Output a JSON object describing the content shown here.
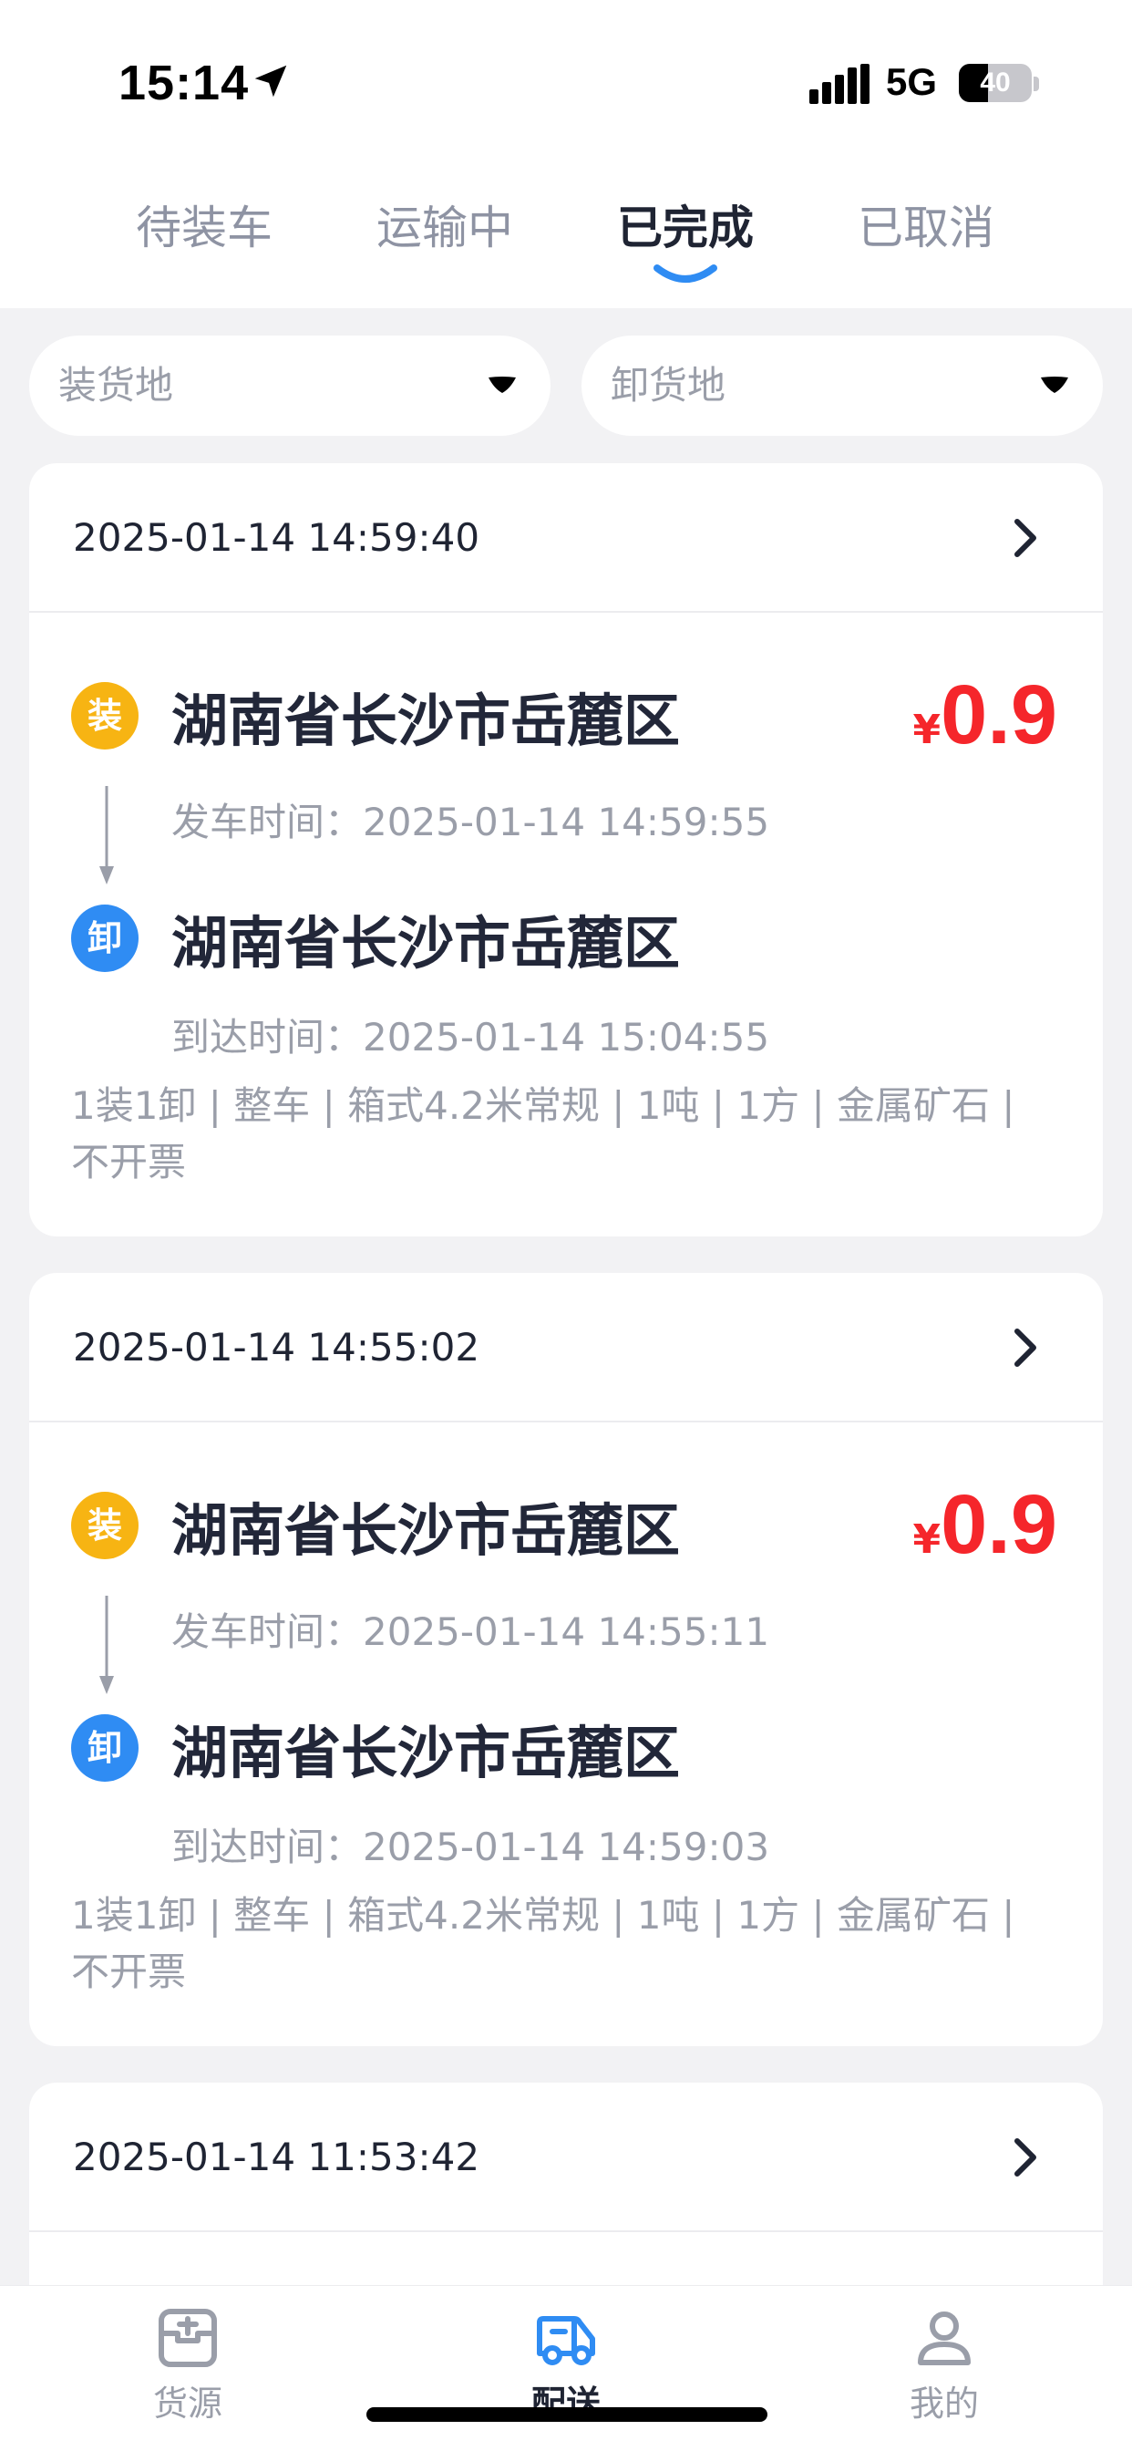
{
  "status_bar": {
    "time": "15:14",
    "network": "5G",
    "battery": "40",
    "battery_level": 0.4
  },
  "tabs": [
    {
      "label": "待装车",
      "active": false
    },
    {
      "label": "运输中",
      "active": false
    },
    {
      "label": "已完成",
      "active": true
    },
    {
      "label": "已取消",
      "active": false
    }
  ],
  "filters": {
    "load_place": "装货地",
    "unload_place": "卸货地"
  },
  "orders": [
    {
      "datetime": "2025-01-14 14:59:40",
      "load_badge": "装",
      "load_place": "湖南省长沙市岳麓区",
      "depart_label": "发车时间：",
      "depart_time": "2025-01-14 14:59:55",
      "unload_badge": "卸",
      "unload_place": "湖南省长沙市岳麓区",
      "arrive_label": "到达时间：",
      "arrive_time": "2025-01-14 15:04:55",
      "currency": "¥",
      "price": "0.9",
      "specs": "1装1卸 | 整车 | 箱式4.2米常规 | 1吨 | 1方 | 金属矿石 | 不开票"
    },
    {
      "datetime": "2025-01-14 14:55:02",
      "load_badge": "装",
      "load_place": "湖南省长沙市岳麓区",
      "depart_label": "发车时间：",
      "depart_time": "2025-01-14 14:55:11",
      "unload_badge": "卸",
      "unload_place": "湖南省长沙市岳麓区",
      "arrive_label": "到达时间：",
      "arrive_time": "2025-01-14 14:59:03",
      "currency": "¥",
      "price": "0.9",
      "specs": "1装1卸 | 整车 | 箱式4.2米常规 | 1吨 | 1方 | 金属矿石 | 不开票"
    },
    {
      "datetime": "2025-01-14 11:53:42"
    }
  ],
  "bottom_nav": [
    {
      "label": "货源",
      "icon": "cargo-box-icon",
      "active": false
    },
    {
      "label": "配送",
      "icon": "delivery-truck-icon",
      "active": true
    },
    {
      "label": "我的",
      "icon": "profile-icon",
      "active": false
    }
  ],
  "colors": {
    "accent_blue": "#2f8cf3",
    "price_red": "#f5262b",
    "load_badge_yellow": "#f7b413",
    "text_dark": "#1f2433",
    "text_gray": "#9a9ea9",
    "background": "#f2f2f4"
  }
}
